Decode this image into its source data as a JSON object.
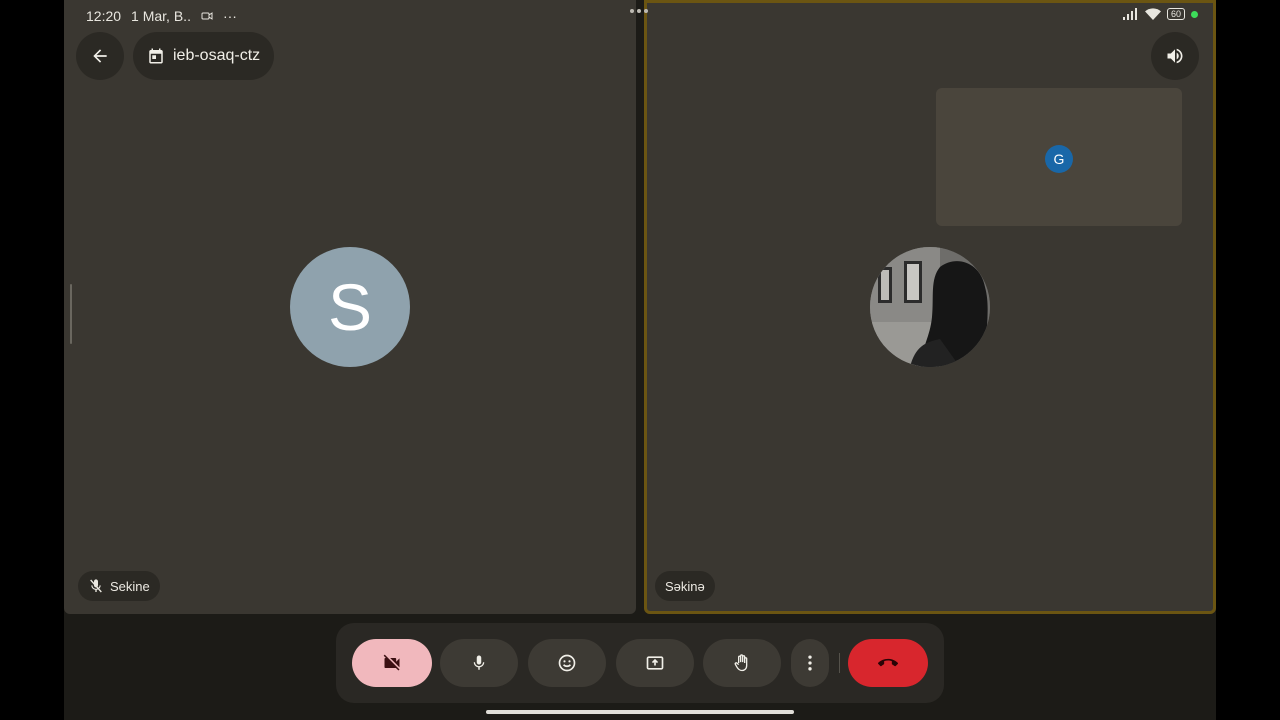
{
  "status_bar": {
    "time": "12:20",
    "date": "1 Mar, B..",
    "overflow": "···",
    "battery": "60"
  },
  "meeting": {
    "code": "ieb-osaq-ctz"
  },
  "participants": {
    "left_avatar_letter": "S",
    "left_name": "Sekine",
    "right_name": "Səkinə",
    "pip_avatar_letter": "G"
  },
  "controls": {
    "camera_icon": "video-off-icon",
    "mic_icon": "mic-icon",
    "reactions_icon": "emoji-icon",
    "present_icon": "present-screen-icon",
    "raise_hand_icon": "hand-icon",
    "more_icon": "more-vert-icon",
    "end_call_icon": "call-end-icon"
  },
  "colors": {
    "end_call": "#d8262d",
    "camera_off_bg": "#f1b8bd",
    "active_speaker_border": "#6b5512",
    "pip_avatar": "#1967a8",
    "avatar_s": "#8fa2ad"
  }
}
